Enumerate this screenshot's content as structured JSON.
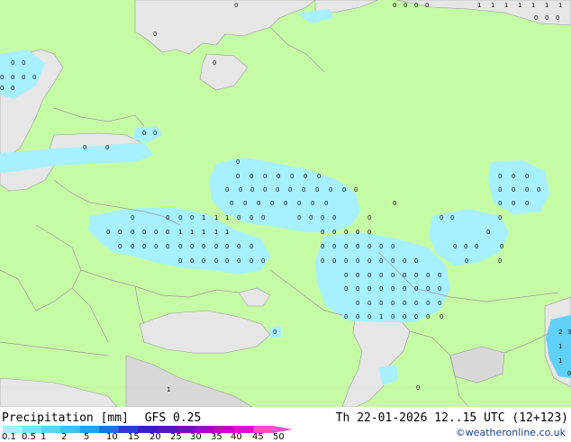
{
  "title": {
    "product": "Precipitation [mm]",
    "model": "GFS 0.25",
    "valid_time": "Th 22-01-2026 12..15 UTC (12+123)"
  },
  "credit": "©weatheronline.co.uk",
  "legend": {
    "ticks": [
      "0.1",
      "0.5",
      "1",
      "2",
      "5",
      "10",
      "15",
      "20",
      "25",
      "30",
      "35",
      "40",
      "45",
      "50"
    ],
    "colors": [
      "#a6f0ff",
      "#7ee2ff",
      "#5fd0f7",
      "#43bff0",
      "#2aa0e2",
      "#1a73d0",
      "#2a40c8",
      "#3a20b8",
      "#5418b0",
      "#7810b0",
      "#9c0cb4",
      "#c00ab8",
      "#e010c0",
      "#f050d0"
    ]
  },
  "colors": {
    "land": "#c6fba6",
    "sea": "#e6e6e6",
    "border": "#9a9a9a",
    "precip_light": "#a6f0ff",
    "precip_medium": "#5fd0f7"
  },
  "map_values": {
    "labels": [
      "0",
      "1",
      "2",
      "3"
    ]
  }
}
